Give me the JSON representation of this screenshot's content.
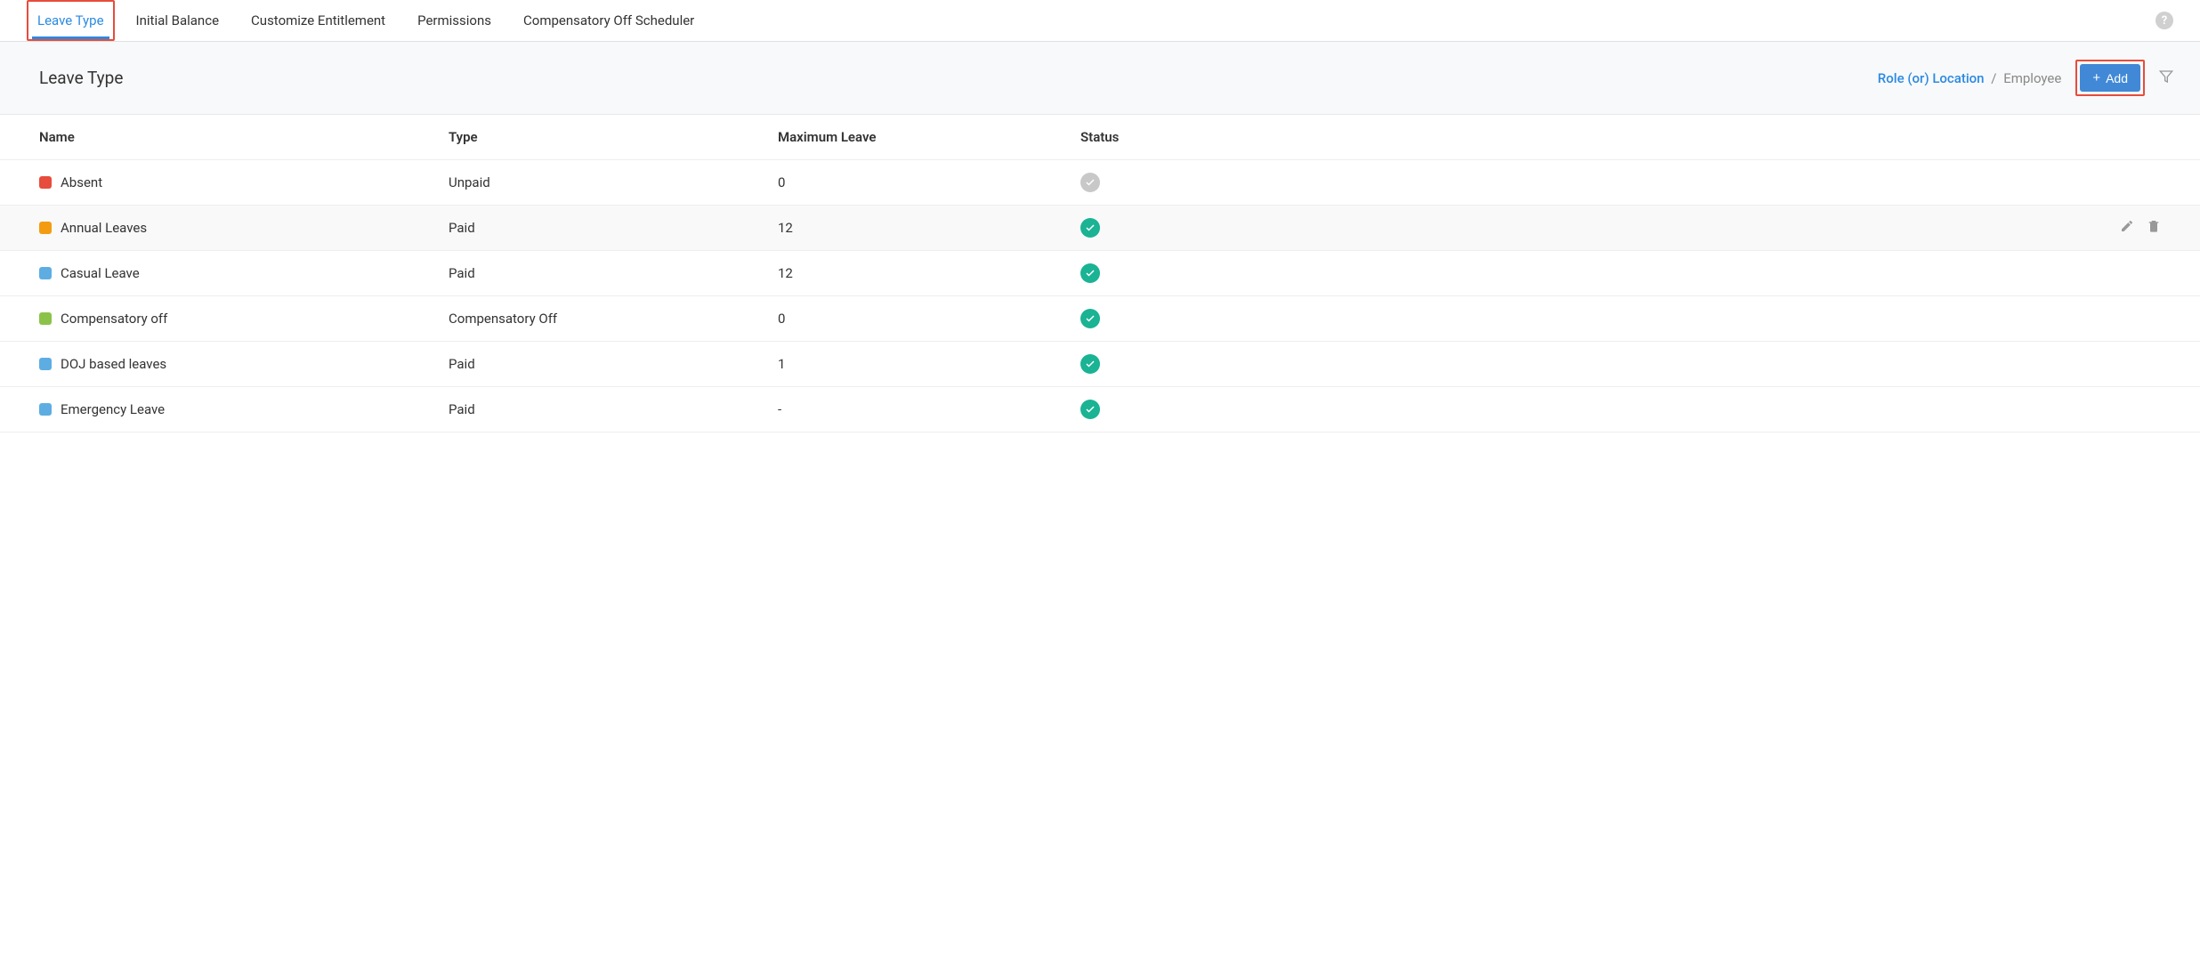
{
  "tabs": [
    {
      "label": "Leave Type",
      "active": true,
      "highlighted": true
    },
    {
      "label": "Initial Balance",
      "active": false,
      "highlighted": false
    },
    {
      "label": "Customize Entitlement",
      "active": false,
      "highlighted": false
    },
    {
      "label": "Permissions",
      "active": false,
      "highlighted": false
    },
    {
      "label": "Compensatory Off Scheduler",
      "active": false,
      "highlighted": false
    }
  ],
  "toolbar": {
    "title": "Leave Type",
    "view_toggle": {
      "active": "Role (or) Location",
      "inactive": "Employee"
    },
    "add_label": "Add"
  },
  "table": {
    "columns": [
      "Name",
      "Type",
      "Maximum Leave",
      "Status"
    ],
    "rows": [
      {
        "color": "#e74c3c",
        "name": "Absent",
        "type": "Unpaid",
        "max": "0",
        "status": "inactive",
        "show_actions": false
      },
      {
        "color": "#f39c12",
        "name": "Annual Leaves",
        "type": "Paid",
        "max": "12",
        "status": "active",
        "show_actions": true
      },
      {
        "color": "#5dade2",
        "name": "Casual Leave",
        "type": "Paid",
        "max": "12",
        "status": "active",
        "show_actions": false
      },
      {
        "color": "#8bc34a",
        "name": "Compensatory off",
        "type": "Compensatory Off",
        "max": "0",
        "status": "active",
        "show_actions": false
      },
      {
        "color": "#5dade2",
        "name": "DOJ based leaves",
        "type": "Paid",
        "max": "1",
        "status": "active",
        "show_actions": false
      },
      {
        "color": "#5dade2",
        "name": "Emergency Leave",
        "type": "Paid",
        "max": "-",
        "status": "active",
        "show_actions": false
      }
    ]
  }
}
